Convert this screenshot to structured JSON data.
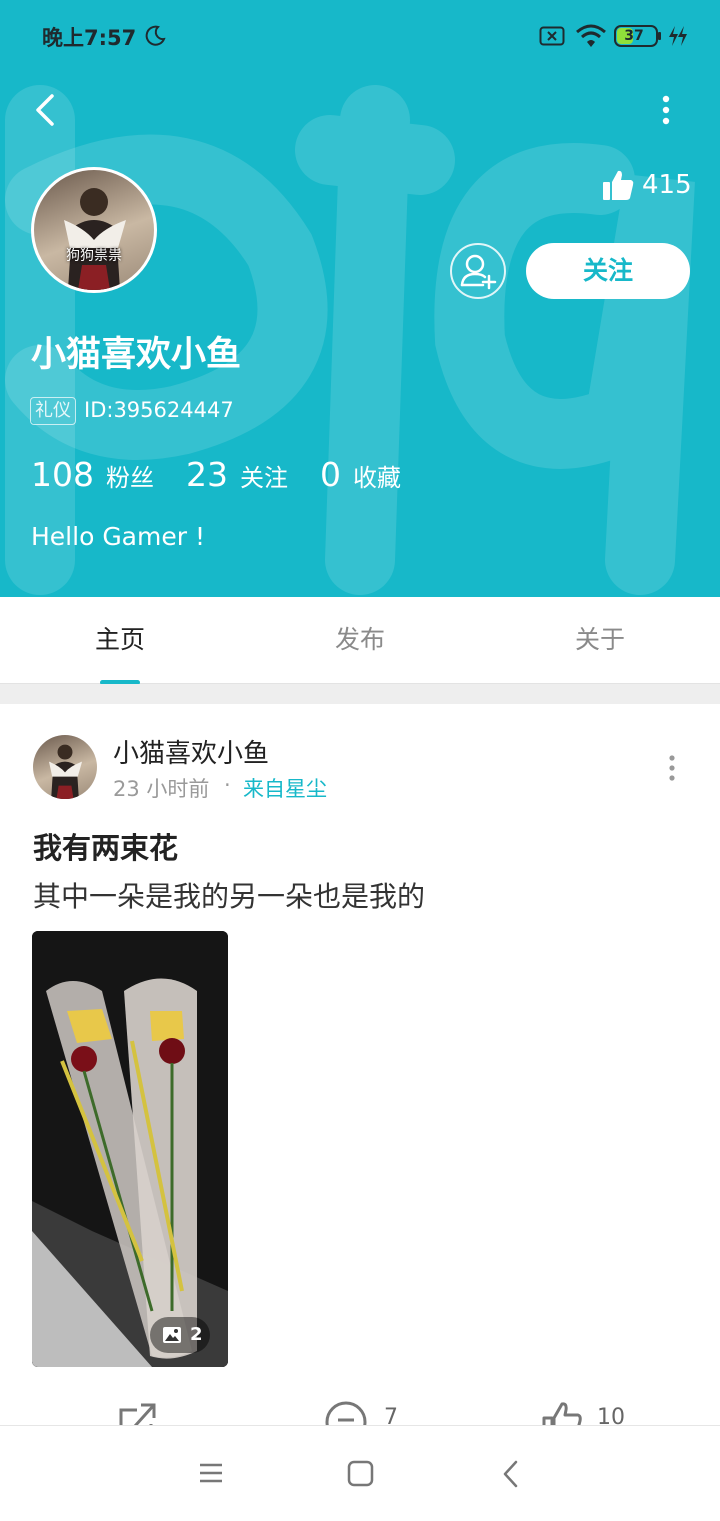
{
  "status_bar": {
    "time": "晚上7:57",
    "battery": "37",
    "icons": [
      "moon-icon",
      "sim-off-icon",
      "wifi-icon",
      "battery-icon",
      "charging-icon"
    ]
  },
  "colors": {
    "accent": "#17b8c9",
    "header_bg": "#17b8c9",
    "text_primary": "#222222",
    "text_secondary": "#9a9a9a"
  },
  "header": {
    "avatar_caption": "狗狗祟祟",
    "like_count": "415",
    "follow_label": "关注",
    "username": "小猫喜欢小鱼",
    "badge": "礼仪",
    "user_id": "ID:395624447",
    "stats": [
      {
        "value": "108",
        "label": "粉丝"
      },
      {
        "value": "23",
        "label": "关注"
      },
      {
        "value": "0",
        "label": "收藏"
      }
    ],
    "bio": "Hello Gamer !"
  },
  "tabs": [
    {
      "label": "主页",
      "active": true
    },
    {
      "label": "发布",
      "active": false
    },
    {
      "label": "关于",
      "active": false
    }
  ],
  "post": {
    "author": "小猫喜欢小鱼",
    "time": "23 小时前",
    "separator": "·",
    "source": "来自星尘",
    "title": "我有两束花",
    "body": "其中一朵是我的另一朵也是我的",
    "image_count": "2",
    "comment_count": "7",
    "like_count": "10"
  }
}
